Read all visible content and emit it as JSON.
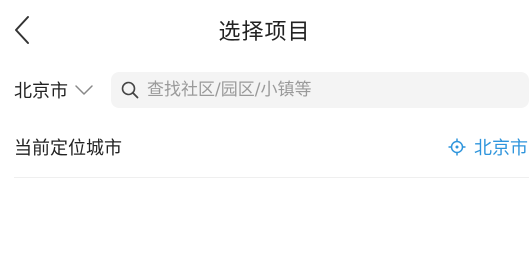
{
  "header": {
    "title": "选择项目"
  },
  "search": {
    "city": "北京市",
    "placeholder": "查找社区/园区/小镇等",
    "value": ""
  },
  "location": {
    "label": "当前定位城市",
    "current_city": "北京市"
  },
  "icons": {
    "back": "chevron-left-icon",
    "dropdown": "chevron-down-icon",
    "search": "search-icon",
    "locate": "crosshair-icon"
  },
  "colors": {
    "accent": "#2f95dc",
    "search_bg": "#f4f4f4",
    "placeholder": "#9a9a9a"
  }
}
